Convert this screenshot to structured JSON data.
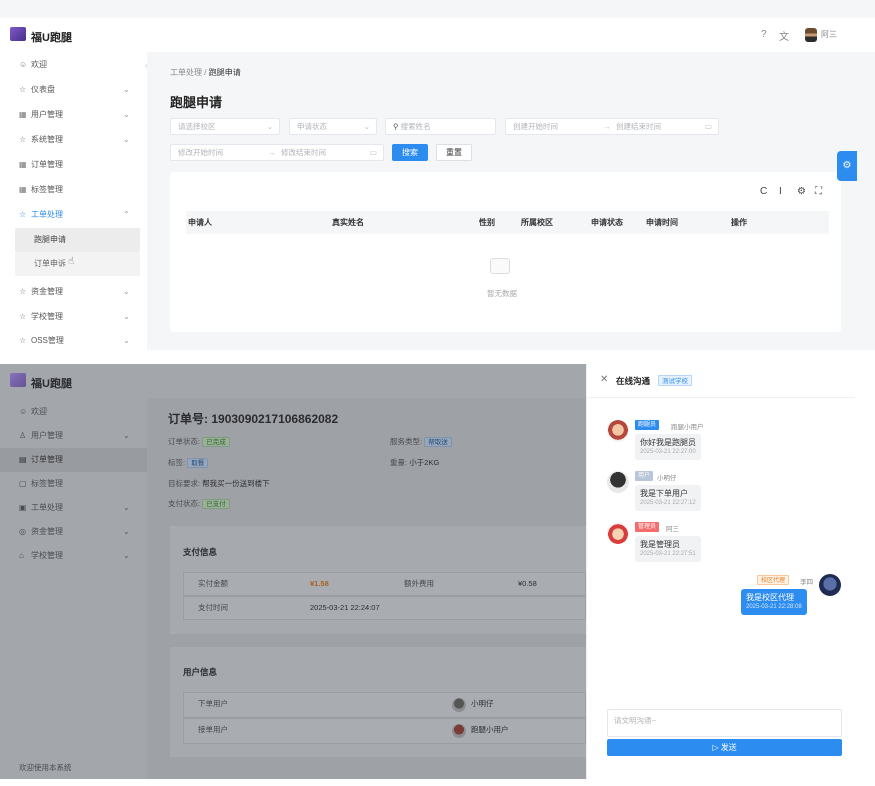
{
  "top": {
    "app_name": "福U跑腿",
    "header_icons": [
      "help-icon",
      "translate-icon"
    ],
    "user_name": "阿三",
    "sidebar": [
      {
        "icon": "☺",
        "label": "欢迎",
        "chevron": ""
      },
      {
        "icon": "☆",
        "label": "仪表盘",
        "chevron": "⌄"
      },
      {
        "icon": "▦",
        "label": "用户管理",
        "chevron": "⌄"
      },
      {
        "icon": "☆",
        "label": "系统管理",
        "chevron": "⌄"
      },
      {
        "icon": "▦",
        "label": "订单管理",
        "chevron": ""
      },
      {
        "icon": "▦",
        "label": "标签管理",
        "chevron": ""
      },
      {
        "icon": "☆",
        "label": "工单处理",
        "chevron": "⌃"
      }
    ],
    "sidebar_sub": [
      "跑腿申请",
      "订单申诉"
    ],
    "sidebar_after": [
      {
        "icon": "☆",
        "label": "资金管理",
        "chevron": "⌄"
      },
      {
        "icon": "☆",
        "label": "学校管理",
        "chevron": "⌄"
      },
      {
        "icon": "☆",
        "label": "OSS管理",
        "chevron": "⌄"
      }
    ],
    "breadcrumb": {
      "parent": "工单处理",
      "sep": "/",
      "current": "跑腿申请"
    },
    "page_title": "跑腿申请",
    "filters": {
      "campus_placeholder": "请选择校区",
      "status_placeholder": "申请状态",
      "search_placeholder": "搜索姓名",
      "create_start": "创建开始时间",
      "create_end": "创建结束时间",
      "update_start": "修改开始时间",
      "update_end": "修改结束时间",
      "range_sep": "→",
      "search_btn": "搜索",
      "reset_btn": "重置"
    },
    "table": {
      "columns": [
        "申请人",
        "真实姓名",
        "性别",
        "所属校区",
        "申请状态",
        "申请时间",
        "操作"
      ],
      "empty_text": "暂无数据"
    }
  },
  "bottom": {
    "app_name": "福U跑腿",
    "sidebar": [
      {
        "icon": "☺",
        "label": "欢迎",
        "chevron": ""
      },
      {
        "icon": "♙",
        "label": "用户管理",
        "chevron": "⌄"
      },
      {
        "icon": "▤",
        "label": "订单管理",
        "chevron": ""
      },
      {
        "icon": "▢",
        "label": "标签管理",
        "chevron": ""
      },
      {
        "icon": "▣",
        "label": "工单处理",
        "chevron": "⌄"
      },
      {
        "icon": "◎",
        "label": "资金管理",
        "chevron": "⌄"
      },
      {
        "icon": "⌂",
        "label": "学校管理",
        "chevron": "⌄"
      }
    ],
    "footer": "欢迎使用本系统",
    "order": {
      "title_label": "订单号:",
      "title_value": "1903090217106862082",
      "status_label": "订单状态:",
      "status_value": "已完成",
      "service_label": "服务类型:",
      "service_value": "帮取送",
      "tag_label": "标签:",
      "tag_value": "取餐",
      "weight_label": "重量:",
      "weight_value": "小于2KG",
      "note_label": "目标要求:",
      "note_value": "帮我买一份送到楼下",
      "pay_status_label": "支付状态:",
      "pay_status_value": "已支付"
    },
    "payment": {
      "title": "支付信息",
      "actual_label": "实付金额",
      "actual_value": "¥1.58",
      "extra_label": "额外费用",
      "extra_value": "¥0.58",
      "time_label": "支付时间",
      "time_value": "2025-03-21 22:24:07"
    },
    "users": {
      "title": "用户信息",
      "orderer_label": "下单用户",
      "orderer_name": "小明仔",
      "runner_label": "接单用户",
      "runner_name": "跑腿小用户"
    }
  },
  "chat": {
    "title": "在线沟通",
    "tag": "测试学校",
    "messages": [
      {
        "role": "跑腿员",
        "role_color": "#2d8cf0",
        "name": "跑腿小用户",
        "text": "你好我是跑腿员",
        "time": "2025-03-21 22:27:00",
        "avatar": "avatar-cartoon-1"
      },
      {
        "role": "用户",
        "role_color": "#b7c6d8",
        "name": "小明仔",
        "text": "我是下单用户",
        "time": "2025-03-21 22:27:12",
        "avatar": "avatar-cartoon-2"
      },
      {
        "role": "管理员",
        "role_color": "#f56c6c",
        "name": "阿三",
        "text": "我是管理员",
        "time": "2025-03-21 22:27:51",
        "avatar": "avatar-cartoon-3"
      },
      {
        "role": "校区代理",
        "role_color": "#fca86b",
        "name": "李四",
        "text": "我是校区代理",
        "time": "2025-03-21 22:28:08",
        "avatar": "avatar-cartoon-4",
        "mine": true
      }
    ],
    "input_placeholder": "请文明沟通~",
    "send_label": "▷ 发送"
  }
}
